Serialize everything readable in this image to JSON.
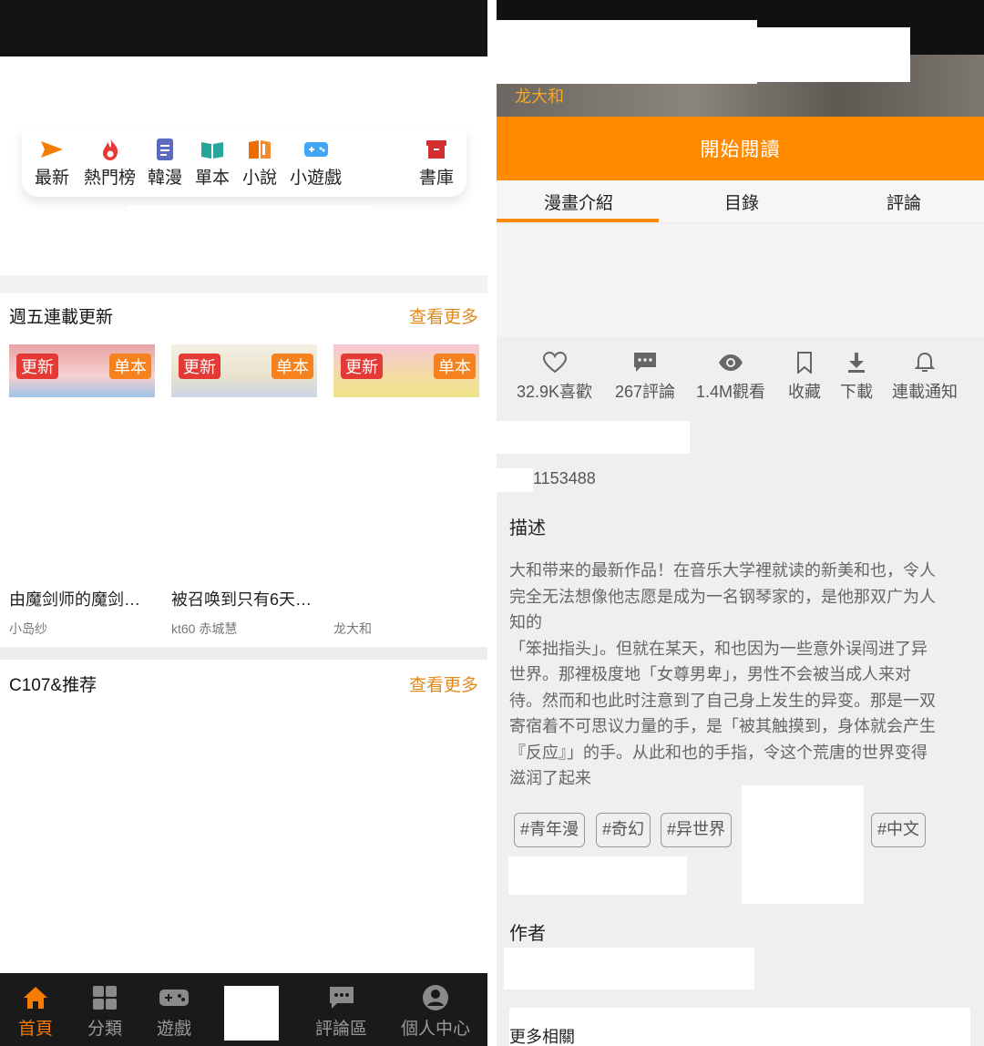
{
  "left": {
    "quicknav": [
      {
        "label": "最新",
        "icon": "send-icon",
        "color": "#f57c00"
      },
      {
        "label": "熱門榜",
        "icon": "fire-icon",
        "color": "#e53935"
      },
      {
        "label": "韓漫",
        "icon": "document-icon",
        "color": "#5c6bc0"
      },
      {
        "label": "單本",
        "icon": "open-book-icon",
        "color": "#26a69a"
      },
      {
        "label": "小說",
        "icon": "book-icon",
        "color": "#ef6c00"
      },
      {
        "label": "小遊戲",
        "icon": "gamepad-icon",
        "color": "#42a5f5"
      },
      {
        "label": "書庫",
        "icon": "archive-icon",
        "color": "#d32f2f"
      }
    ],
    "section1": {
      "title": "週五連載更新",
      "more": "查看更多",
      "cards": [
        {
          "badge_new": "更新",
          "badge_single": "单本",
          "title": "由魔剑师的魔剑…",
          "author": "小岛纱"
        },
        {
          "badge_new": "更新",
          "badge_single": "单本",
          "title": "被召唤到只有6天…",
          "author": "kt60 赤城慧"
        },
        {
          "badge_new": "更新",
          "badge_single": "单本",
          "title": "",
          "author": "龙大和"
        }
      ]
    },
    "section2": {
      "title": "C107&推荐",
      "more": "查看更多"
    },
    "bottom_nav": [
      {
        "label": "首頁",
        "icon": "home-icon",
        "active": true
      },
      {
        "label": "分類",
        "icon": "grid-icon",
        "active": false
      },
      {
        "label": "遊戲",
        "icon": "gamepad-icon",
        "active": false
      },
      {
        "label": "評論區",
        "icon": "comment-icon",
        "active": false
      },
      {
        "label": "個人中心",
        "icon": "user-icon",
        "active": false
      }
    ]
  },
  "right": {
    "author_top": "龙大和",
    "start_read": "開始閱讀",
    "tabs": [
      "漫畫介紹",
      "目錄",
      "評論"
    ],
    "stats": [
      {
        "label": "32.9K喜歡",
        "icon": "heart-icon"
      },
      {
        "label": "267評論",
        "icon": "comment-icon"
      },
      {
        "label": "1.4M觀看",
        "icon": "eye-icon"
      },
      {
        "label": "收藏",
        "icon": "bookmark-icon"
      },
      {
        "label": "下載",
        "icon": "download-icon"
      },
      {
        "label": "連載通知",
        "icon": "bell-icon"
      }
    ],
    "id_text": "1153488",
    "desc_title": "描述",
    "desc_lines": [
      "大和带来的最新作品！在音乐大学裡就读的新美和也，令人",
      "完全无法想像他志愿是成为一名钢琴家的，是他那双广为人",
      "知的",
      "「笨拙指头」。但就在某天，和也因为一些意外误闯进了异",
      "世界。那裡极度地「女尊男卑」，男性不会被当成人来对",
      "待。然而和也此时注意到了自己身上发生的异变。那是一双",
      "寄宿着不可思议力量的手，是「被其触摸到，身体就会产生",
      "『反应』」的手。从此和也的手指，令这个荒唐的世界变得",
      "滋润了起来"
    ],
    "tags": [
      "#青年漫",
      "#奇幻",
      "#异世界",
      "#中文"
    ],
    "author_title": "作者",
    "more_related": "更多相關"
  },
  "colors": {
    "accent": "#ff8a00",
    "link": "#e08a1e",
    "badge_red": "#e53935"
  }
}
